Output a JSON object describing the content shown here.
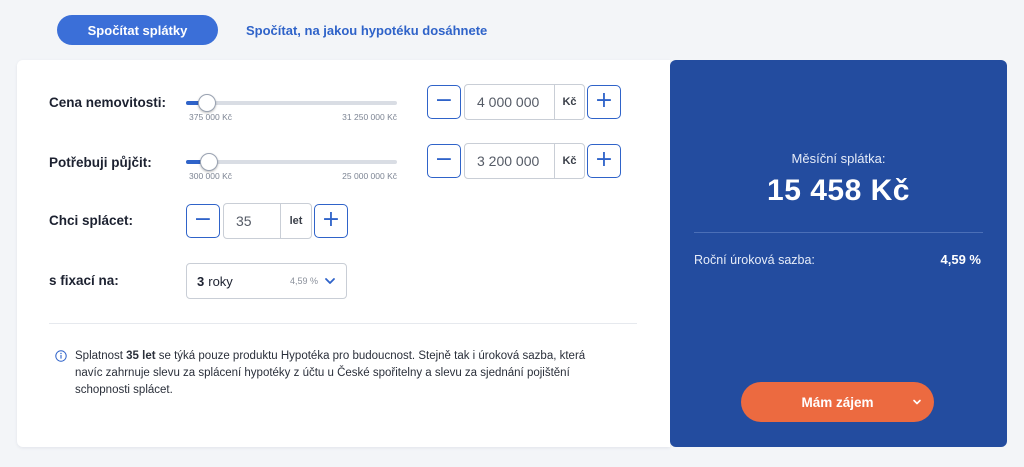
{
  "tabs": {
    "active": "Spočítat splátky",
    "other": "Spočítat, na jakou hypotéku dosáhnete"
  },
  "price": {
    "label": "Cena nemovitosti:",
    "slider_min": "375 000 Kč",
    "slider_max": "31 250 000 Kč",
    "slider_level": 0.1,
    "value": "4 000 000",
    "unit": "Kč"
  },
  "loan": {
    "label": "Potřebuji půjčit:",
    "slider_min": "300 000 Kč",
    "slider_max": "25 000 000 Kč",
    "slider_level": 0.11,
    "value": "3 200 000",
    "unit": "Kč"
  },
  "term": {
    "label": "Chci splácet:",
    "value": "35",
    "unit": "let"
  },
  "fixation": {
    "label": "s fixací na:",
    "number": "3",
    "word": "roky",
    "rate": "4,59 %"
  },
  "note": {
    "part1": "Splatnost ",
    "bold": "35 let",
    "part2": " se týká pouze produktu Hypotéka pro budoucnost. Stejně tak i úroková sazba, která navíc zahrnuje slevu za splácení hypotéky z účtu u České spořitelny a slevu za sjednání pojištění schopnosti splácet."
  },
  "result": {
    "monthly_label": "Měsíční splátka:",
    "monthly_value": "15 458 Kč",
    "rate_label": "Roční úroková sazba:",
    "rate_value": "4,59 %",
    "cta_label": "Mám zájem"
  },
  "controls": {
    "minus": "−",
    "plus": "+"
  },
  "colors": {
    "accent": "#2f63c9",
    "panel": "#234c9f",
    "cta": "#ec6a40"
  },
  "icons": [
    "minus-icon",
    "plus-icon",
    "chevron-down-icon",
    "info-icon"
  ]
}
